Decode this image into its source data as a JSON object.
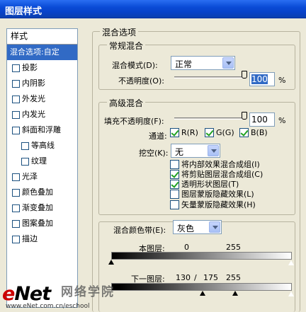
{
  "window": {
    "title": "图层样式"
  },
  "sidebar": {
    "header": "样式",
    "items": [
      {
        "label": "混合选项:自定",
        "selected": true,
        "checkbox": false
      },
      {
        "label": "投影",
        "checkbox": true
      },
      {
        "label": "内阴影",
        "checkbox": true
      },
      {
        "label": "外发光",
        "checkbox": true
      },
      {
        "label": "内发光",
        "checkbox": true
      },
      {
        "label": "斜面和浮雕",
        "checkbox": true
      },
      {
        "label": "等高线",
        "checkbox": true,
        "sub": true
      },
      {
        "label": "纹理",
        "checkbox": true,
        "sub": true
      },
      {
        "label": "光泽",
        "checkbox": true
      },
      {
        "label": "颜色叠加",
        "checkbox": true
      },
      {
        "label": "渐变叠加",
        "checkbox": true
      },
      {
        "label": "图案叠加",
        "checkbox": true
      },
      {
        "label": "描边",
        "checkbox": true
      }
    ]
  },
  "blend": {
    "group_title": "混合选项",
    "general": {
      "title": "常规混合",
      "mode_label": "混合模式(D):",
      "mode_value": "正常",
      "opacity_label": "不透明度(O):",
      "opacity_value": "100",
      "pct": "%"
    },
    "advanced": {
      "title": "高级混合",
      "fill_label": "填充不透明度(F):",
      "fill_value": "100",
      "pct": "%",
      "channels_label": "通道:",
      "ch_r": "R(R)",
      "ch_g": "G(G)",
      "ch_b": "B(B)",
      "knockout_label": "挖空(K):",
      "knockout_value": "无",
      "options": [
        {
          "label": "将内部效果混合成组(I)",
          "checked": false
        },
        {
          "label": "将剪贴图层混合成组(C)",
          "checked": true
        },
        {
          "label": "透明形状图层(T)",
          "checked": true
        },
        {
          "label": "图层蒙版隐藏效果(L)",
          "checked": false
        },
        {
          "label": "矢量蒙版隐藏效果(H)",
          "checked": false
        }
      ]
    },
    "blend_if": {
      "label": "混合颜色带(E):",
      "value": "灰色",
      "this_layer": "本图层:",
      "this_low": "0",
      "this_high": "255",
      "under_layer": "下一图层:",
      "under_low": "130",
      "under_sep": "/",
      "under_mid": "175",
      "under_high": "255"
    }
  },
  "watermark": {
    "logo_e": "e",
    "logo_rest": "Net",
    "cn": "网络学院",
    "url": "www.eNet.com.cn/eschool"
  }
}
